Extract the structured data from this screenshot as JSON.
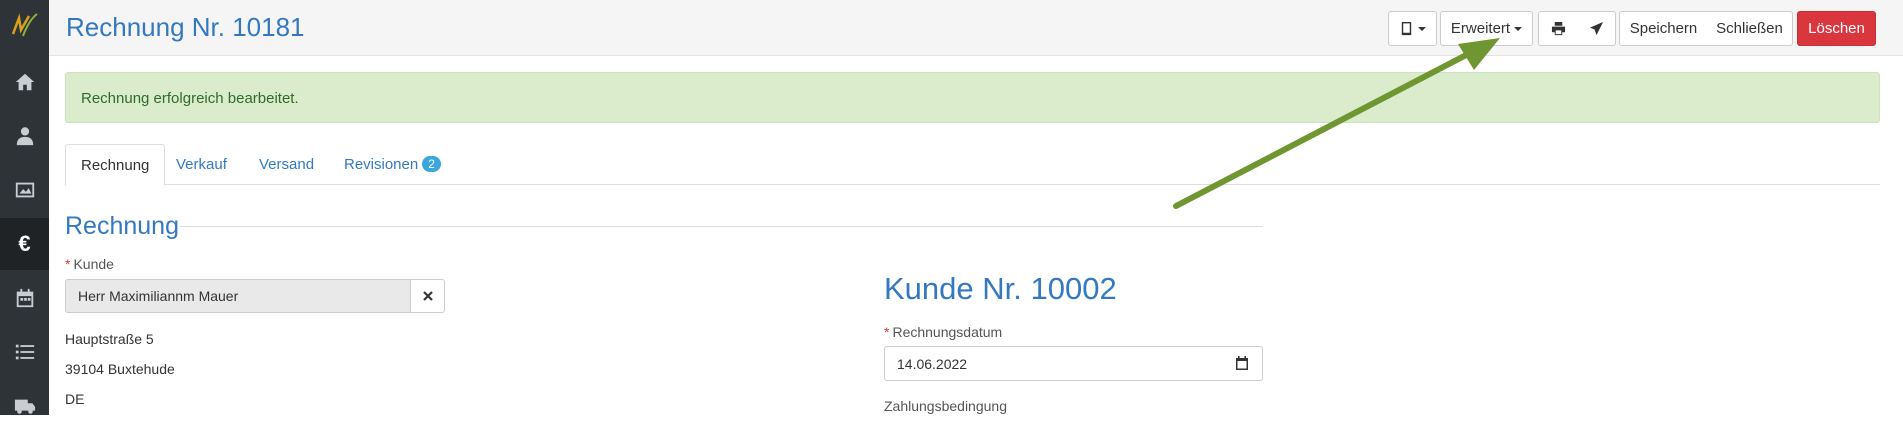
{
  "sidebar": {
    "items": [
      {
        "icon": "logo-icon"
      },
      {
        "icon": "home-icon"
      },
      {
        "icon": "user-tie-icon"
      },
      {
        "icon": "image-icon"
      },
      {
        "icon": "euro-icon",
        "glyph": "€",
        "active": true
      },
      {
        "icon": "calendar-icon"
      },
      {
        "icon": "list-icon"
      },
      {
        "icon": "truck-icon"
      }
    ]
  },
  "header": {
    "title": "Rechnung Nr. 10181",
    "buttons": {
      "device": "",
      "erweitert": "Erweitert",
      "speichern": "Speichern",
      "schliessen": "Schließen",
      "loeschen": "Löschen"
    }
  },
  "alert": {
    "message": "Rechnung erfolgreich bearbeitet."
  },
  "tabs": [
    {
      "label": "Rechnung",
      "active": true
    },
    {
      "label": "Verkauf"
    },
    {
      "label": "Versand"
    },
    {
      "label": "Revisionen",
      "badge": "2"
    }
  ],
  "section": {
    "title": "Rechnung"
  },
  "form": {
    "kunde_label": "Kunde",
    "kunde_value": "Herr Maximiliannm Mauer",
    "address": [
      "Hauptstraße 5",
      "39104 Buxtehude",
      "DE"
    ],
    "kunde_nr": "Kunde Nr. 10002",
    "rechnungsdatum_label": "Rechnungsdatum",
    "rechnungsdatum_value": "14.06.2022",
    "zahlungsbedingung_label": "Zahlungsbedingung"
  },
  "colors": {
    "accent": "#3479c0",
    "danger": "#d9363e",
    "success_bg": "#dbeccd",
    "annotation_arrow": "#6f9630"
  }
}
